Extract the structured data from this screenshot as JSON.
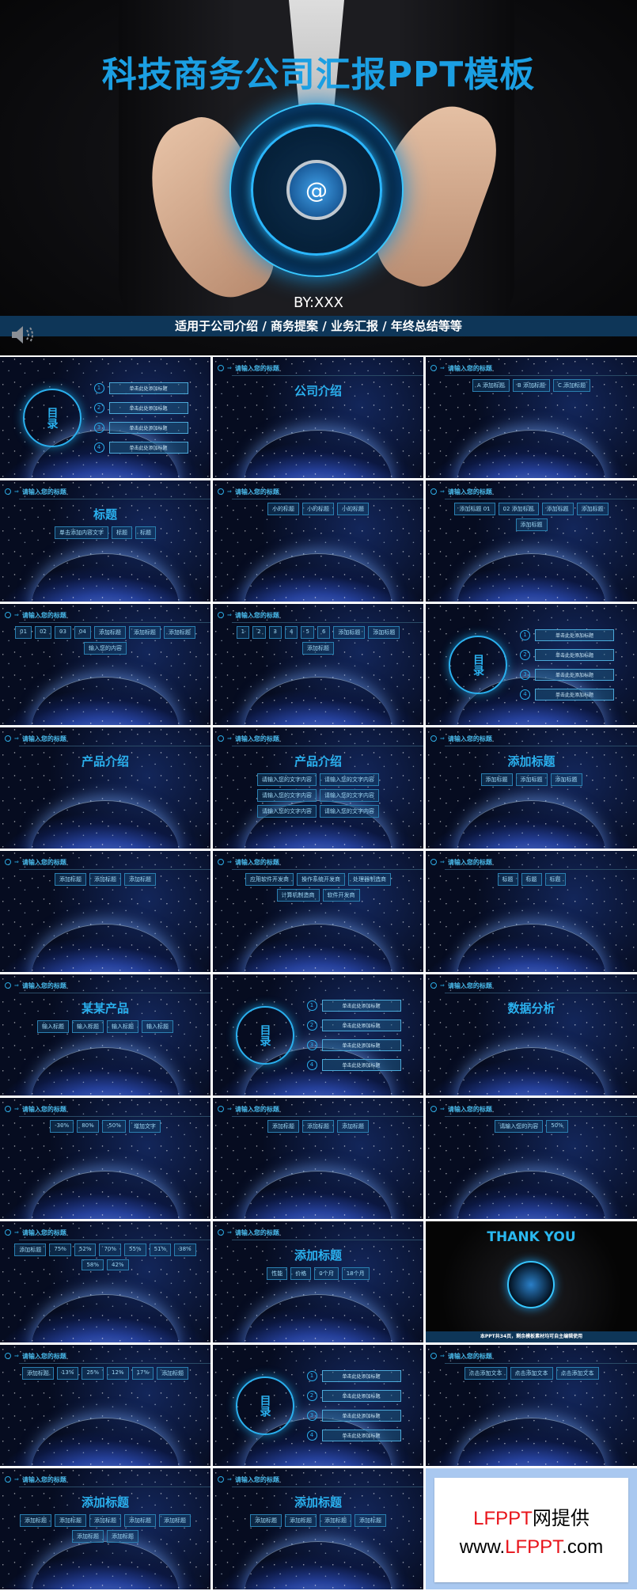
{
  "hero": {
    "title": "科技商务公司汇报PPT模板",
    "author": "BY:XXX",
    "tagline": "适用于公司介绍 / 商务提案 / 业务汇报 / 年终总结等等",
    "orb_symbol": "@",
    "accent": "#1b9fe3",
    "band_color": "#0e3658"
  },
  "slides": [
    {
      "type": "toc",
      "heading": "目录",
      "items": [
        "单击此处添加标题",
        "单击此处添加标题",
        "单击此处添加标题",
        "单击此处添加标题"
      ]
    },
    {
      "type": "content",
      "title": "请输入您的标题",
      "heading": "公司介绍",
      "items": []
    },
    {
      "type": "content",
      "title": "请输入您的标题",
      "heading": "",
      "items": [
        "A 添加标题",
        "B 添加标题",
        "C 添加标题"
      ]
    },
    {
      "type": "content",
      "title": "请输入您的标题",
      "heading": "标题",
      "items": [
        "单击添加内容文字",
        "标题",
        "标题"
      ]
    },
    {
      "type": "content",
      "title": "请输入您的标题",
      "heading": "",
      "items": [
        "小的标题",
        "小的标题",
        "小的标题"
      ]
    },
    {
      "type": "content",
      "title": "请输入您的标题",
      "heading": "",
      "items": [
        "添加标题 01",
        "02 添加标题",
        "添加标题",
        "添加标题",
        "添加标题"
      ]
    },
    {
      "type": "content",
      "title": "请输入您的标题",
      "heading": "",
      "items": [
        "01",
        "02",
        "03",
        "04",
        "添加标题",
        "添加标题",
        "添加标题",
        "输入您的内容"
      ]
    },
    {
      "type": "content",
      "title": "请输入您的标题",
      "heading": "",
      "items": [
        "1",
        "2",
        "3",
        "4",
        "5",
        "6",
        "添加标题",
        "添加标题",
        "添加标题"
      ]
    },
    {
      "type": "toc",
      "heading": "目录",
      "items": [
        "单击此处添加标题",
        "单击此处添加标题",
        "单击此处添加标题",
        "单击此处添加标题"
      ]
    },
    {
      "type": "content",
      "title": "请输入您的标题",
      "heading": "产品介绍",
      "items": []
    },
    {
      "type": "content",
      "title": "请输入您的标题",
      "heading": "产品介绍",
      "items": [
        "请输入您的文字内容",
        "请输入您的文字内容",
        "请输入您的文字内容",
        "请输入您的文字内容",
        "请输入您的文字内容",
        "请输入您的文字内容"
      ]
    },
    {
      "type": "content",
      "title": "请输入您的标题",
      "heading": "添加标题",
      "items": [
        "添加标题",
        "添加标题",
        "添加标题"
      ]
    },
    {
      "type": "content",
      "title": "请输入您的标题",
      "heading": "",
      "items": [
        "添加标题",
        "添加标题",
        "添加标题"
      ]
    },
    {
      "type": "content",
      "title": "请输入您的标题",
      "heading": "",
      "items": [
        "应用软件开发商",
        "操作系统开发商",
        "处理器制造商",
        "计算机制造商",
        "软件开发商"
      ]
    },
    {
      "type": "content",
      "title": "请输入您的标题",
      "heading": "",
      "items": [
        "标题",
        "标题",
        "标题"
      ]
    },
    {
      "type": "content",
      "title": "请输入您的标题",
      "heading": "某某产品",
      "items": [
        "输入标题",
        "输入标题",
        "输入标题",
        "输入标题"
      ]
    },
    {
      "type": "toc",
      "heading": "目录",
      "items": [
        "单击此处添加标题",
        "单击此处添加标题",
        "单击此处添加标题",
        "单击此处添加标题"
      ]
    },
    {
      "type": "content",
      "title": "请输入您的标题",
      "heading": "数据分析",
      "items": []
    },
    {
      "type": "content",
      "title": "请输入您的标题",
      "heading": "",
      "items": [
        "-30%",
        "80%",
        "-50%",
        "增加文字"
      ]
    },
    {
      "type": "content",
      "title": "请输入您的标题",
      "heading": "",
      "items": [
        "添加标题",
        "添加标题",
        "添加标题"
      ]
    },
    {
      "type": "content",
      "title": "请输入您的标题",
      "heading": "",
      "items": [
        "请输入您的内容",
        "50%"
      ]
    },
    {
      "type": "content",
      "title": "请输入您的标题",
      "heading": "",
      "items": [
        "添加标题",
        "75%",
        "52%",
        "70%",
        "55%",
        "51%",
        "38%",
        "58%",
        "42%"
      ]
    },
    {
      "type": "content",
      "title": "请输入您的标题",
      "heading": "添加标题",
      "items": [
        "性能",
        "价格",
        "0个月",
        "18个月"
      ]
    },
    {
      "type": "thanks",
      "heading": "THANK YOU",
      "footer": "本PPT共34页，剩余模板素材均可自主编辑使用"
    },
    {
      "type": "content",
      "title": "请输入您的标题",
      "heading": "",
      "items": [
        "添加标题",
        "13%",
        "25%",
        "12%",
        "17%",
        "添加标题"
      ]
    },
    {
      "type": "toc",
      "heading": "目录",
      "items": [
        "单击此处添加标题",
        "单击此处添加标题",
        "单击此处添加标题",
        "单击此处添加标题"
      ]
    },
    {
      "type": "content",
      "title": "请输入您的标题",
      "heading": "",
      "items": [
        "点击添加文本",
        "点击添加文本",
        "点击添加文本"
      ]
    },
    {
      "type": "content",
      "title": "请输入您的标题",
      "heading": "添加标题",
      "items": [
        "添加标题",
        "添加标题",
        "添加标题",
        "添加标题",
        "添加标题",
        "添加标题",
        "添加标题"
      ]
    },
    {
      "type": "content",
      "title": "请输入您的标题",
      "heading": "添加标题",
      "items": [
        "添加标题",
        "添加标题",
        "添加标题",
        "添加标题"
      ]
    },
    {
      "type": "ad",
      "line1": "LFPPT",
      "line1b": "网提供",
      "line2a": "www.",
      "line2b": "LFPPT",
      ".com": ".com",
      "line2c": ".com"
    }
  ]
}
